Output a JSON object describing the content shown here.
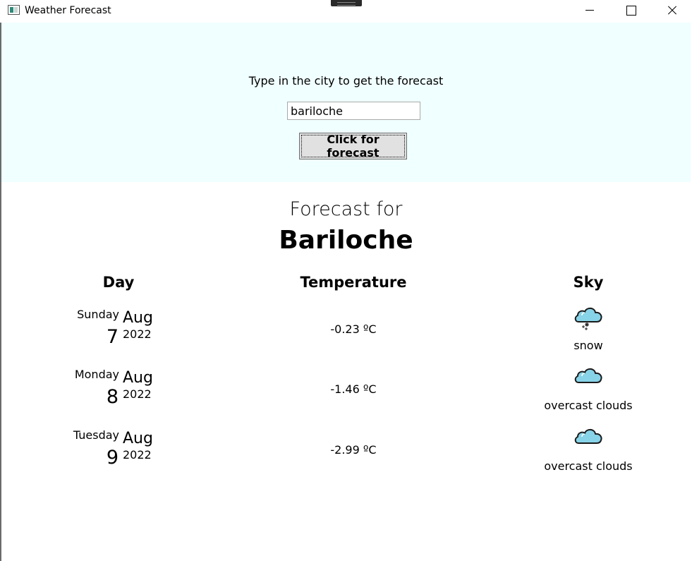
{
  "window": {
    "title": "Weather Forecast"
  },
  "search": {
    "prompt": "Type in the city to get the forecast",
    "value": "bariloche",
    "button_label": "Click for forecast"
  },
  "forecast": {
    "heading": "Forecast for",
    "city": "Bariloche",
    "columns": {
      "day": "Day",
      "temperature": "Temperature",
      "sky": "Sky"
    },
    "rows": [
      {
        "weekday": "Sunday",
        "month": "Aug",
        "day": "7",
        "year": "2022",
        "temperature": "-0.23 ºC",
        "sky": "snow",
        "icon": "snow-cloud-icon"
      },
      {
        "weekday": "Monday",
        "month": "Aug",
        "day": "8",
        "year": "2022",
        "temperature": "-1.46 ºC",
        "sky": "overcast clouds",
        "icon": "cloud-icon"
      },
      {
        "weekday": "Tuesday",
        "month": "Aug",
        "day": "9",
        "year": "2022",
        "temperature": "-2.99 ºC",
        "sky": "overcast clouds",
        "icon": "cloud-icon"
      }
    ]
  },
  "colors": {
    "search_panel_background": "#f0ffff",
    "cloud_fill": "#87d3e8"
  }
}
